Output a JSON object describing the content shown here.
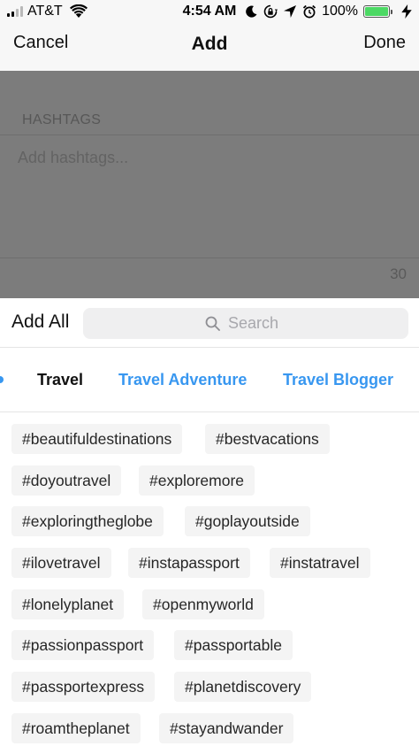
{
  "status_bar": {
    "carrier": "AT&T",
    "time": "4:54 AM",
    "battery_percent": "100%",
    "battery_color": "#4cd964"
  },
  "nav": {
    "cancel_label": "Cancel",
    "title": "Add",
    "done_label": "Done"
  },
  "editor": {
    "section_label": "HASHTAGS",
    "placeholder": "Add hashtags...",
    "remaining_count": "30"
  },
  "search_row": {
    "add_all_label": "Add All",
    "search_placeholder": "Search"
  },
  "category_tabs": [
    {
      "label": "Travel",
      "selected": true
    },
    {
      "label": "Travel Adventure",
      "selected": false
    },
    {
      "label": "Travel Blogger",
      "selected": false
    }
  ],
  "hashtags": [
    "#beautifuldestinations",
    "#bestvacations",
    "#doyoutravel",
    "#exploremore",
    "#exploringtheglobe",
    "#goplayoutside",
    "#ilovetravel",
    "#instapassport",
    "#instatravel",
    "#lonelyplanet",
    "#openmyworld",
    "#passionpassport",
    "#passportable",
    "#passportexpress",
    "#planetdiscovery",
    "#roamtheplanet",
    "#stayandwander"
  ],
  "colors": {
    "accent": "#3897f0",
    "overlay": "#7c7c7c",
    "chip_background": "#f4f4f4"
  },
  "icons": [
    "wifi-icon",
    "moon-icon",
    "rotation-lock-icon",
    "location-arrow-icon",
    "alarm-icon",
    "battery-icon",
    "charging-bolt-icon",
    "search-icon"
  ]
}
